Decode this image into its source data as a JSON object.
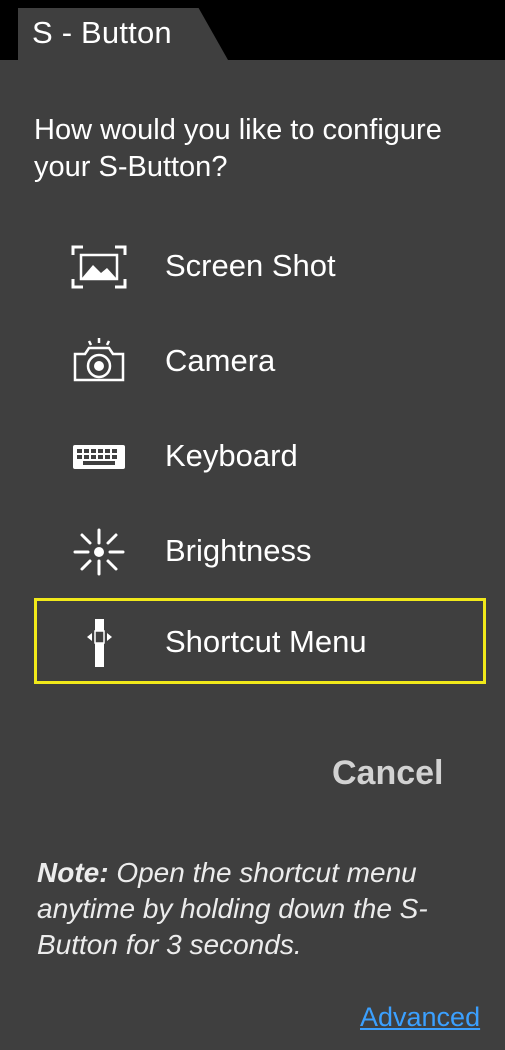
{
  "tab": {
    "title": "S - Button"
  },
  "prompt": "How would you like to configure your S-Button?",
  "options": [
    {
      "label": "Screen Shot",
      "icon": "screenshot-icon",
      "selected": false
    },
    {
      "label": "Camera",
      "icon": "camera-icon",
      "selected": false
    },
    {
      "label": "Keyboard",
      "icon": "keyboard-icon",
      "selected": false
    },
    {
      "label": "Brightness",
      "icon": "brightness-icon",
      "selected": false
    },
    {
      "label": "Shortcut Menu",
      "icon": "shortcut-menu-icon",
      "selected": true
    }
  ],
  "cancel_label": "Cancel",
  "note": {
    "label": "Note:",
    "text": " Open the shortcut menu anytime by holding down the S-Button for 3 seconds."
  },
  "advanced_label": "Advanced",
  "colors": {
    "background": "#3f3f3f",
    "header": "#000000",
    "selection_border": "#f1e91a",
    "link": "#3ba0ff",
    "cancel": "#d2d2d2"
  }
}
